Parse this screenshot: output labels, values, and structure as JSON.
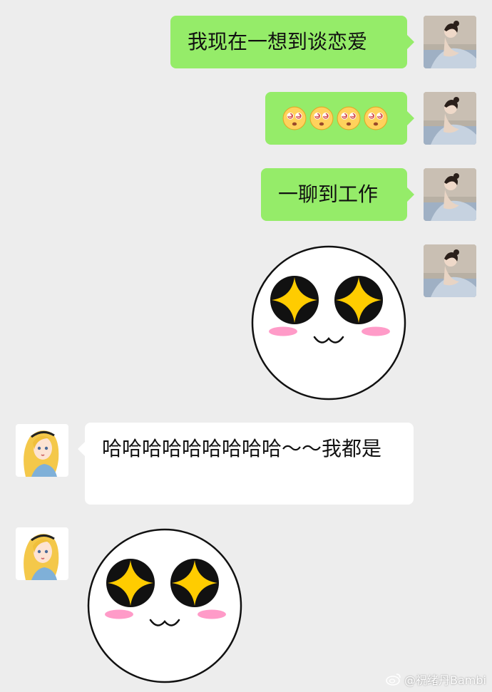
{
  "colors": {
    "background": "#ededed",
    "self_bubble": "#95ec69",
    "other_bubble": "#ffffff",
    "sticker_diamond": "#ffcc00",
    "sticker_blush": "#ff9bc8"
  },
  "messages": [
    {
      "sender": "self",
      "type": "text",
      "text": "我现在一想到谈恋爱"
    },
    {
      "sender": "self",
      "type": "emoji",
      "emojis": [
        "dizzy-face",
        "dizzy-face",
        "dizzy-face",
        "dizzy-face"
      ]
    },
    {
      "sender": "self",
      "type": "text",
      "text": "一聊到工作"
    },
    {
      "sender": "self",
      "type": "sticker",
      "sticker": "starry-eyes-face"
    },
    {
      "sender": "other",
      "type": "text",
      "text": "哈哈哈哈哈哈哈哈哈～～我都是"
    },
    {
      "sender": "other",
      "type": "sticker",
      "sticker": "starry-eyes-face"
    }
  ],
  "watermark": {
    "text": "@祝绪丹Bambi"
  }
}
